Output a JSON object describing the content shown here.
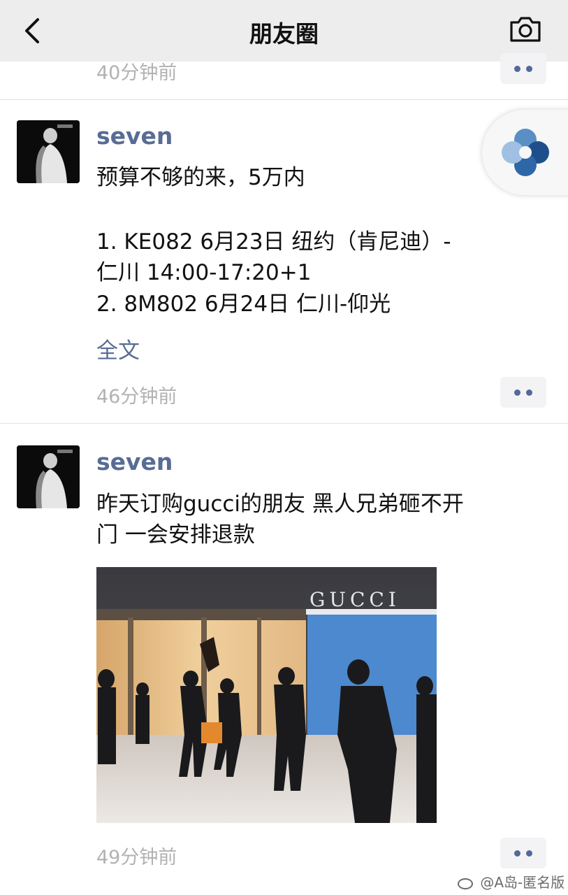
{
  "navbar": {
    "title": "朋友圈",
    "back_icon": "chevron-left-icon",
    "camera_icon": "camera-icon"
  },
  "posts": [
    {
      "time": "40分钟前"
    },
    {
      "nickname": "seven",
      "lines": [
        "预算不够的来，5万内",
        "1. KE082   6月23日    纽约（肯尼迪）-",
        "仁川  14:00-17:20+1",
        "2. 8M802   6月24日    仁川-仰光"
      ],
      "fulltext_label": "全文",
      "time": "46分钟前"
    },
    {
      "nickname": "seven",
      "lines": [
        "昨天订购gucci的朋友  黑人兄弟砸不开",
        "门  一会安排退款"
      ],
      "image_sign_text": "GUCCI",
      "time": "49分钟前"
    }
  ],
  "watermark": "@A岛-匿名版",
  "colors": {
    "navbar_bg": "#ededed",
    "nickname": "#586c94",
    "time": "#b2b2b2"
  }
}
